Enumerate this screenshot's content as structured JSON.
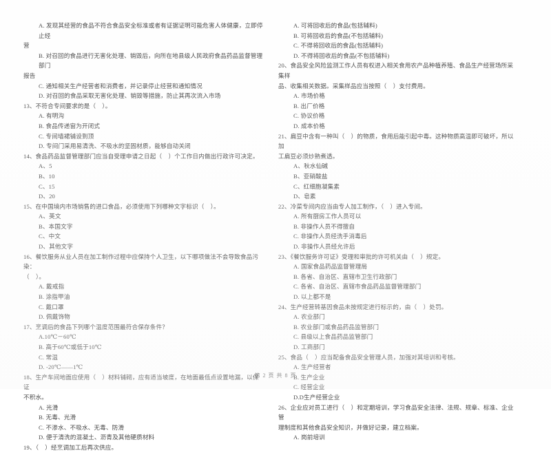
{
  "document": {
    "type": "exam-paper",
    "footer": "第 2 页 共 8 页",
    "page_number": "2",
    "total_pages": "8"
  },
  "left_column": {
    "lines": [
      "   A. 发现其经营的食品不符合食品安全标准或者有证据证明可能危害人体健康，立即停止经",
      "营",
      "   B. 对召回的食品进行无害化处理、销毁后，向所在地县级人民政府食品药品监督管理部门",
      "报告",
      "   C. 通知相关生产经营者和消费者，并记录停止经营和通知情况",
      "   D. 对召回的食品采取无害化处理、销毁等措施，防止其再次流入市场",
      "13、不符合专间要求的是（    ）。",
      "   A. 有明沟",
      "   B. 食品传递窗为开闭式",
      "   C. 专间墙裙铺设到顶",
      "   D. 专间门采用易清洗、不吸水的坚固材质，能够自动关闭",
      "14、食品药品监督管理部门应当自受理申请之日起（    ）个工作日内做出行政许可决定。",
      "   A、5",
      "   B、10",
      "   C、15",
      "   D、20",
      "15、在中国境内市场销售的进口食品，必须使用下列哪种文字标识（    ）。",
      "   A、英文",
      "   B、本国文字",
      "   C、中文",
      "   D、其他文字",
      "16、餐饮服务从业人员在加工制作过程中应保持个人卫生，以下哪项做法不会导致食品污染：",
      "（    ）。",
      "   A. 戴戒指",
      "   B. 涂指甲油",
      "   C. 戴口罩",
      "   D. 佩戴饰物",
      "17、烹调后的食品下列哪个温度范围最符合保存条件？",
      "   A.10℃－60℃",
      "   B. 高于60℃或低于10℃",
      "   C. 常温",
      "   D. -20℃——1℃",
      "18、生产车间地面应使用（    ）材料铺砌，应有适当坡度，在地面最低点设置地漏，以保证",
      "不积水。",
      "   A. 光滑",
      "   B. 无毒、光滑",
      "   C. 不渗水、不吸水、无毒、防滑",
      "   D. 便于清洗的混凝土、沥青及其他硬质材料",
      "19、（    ）经烹调加工后再次供应。"
    ]
  },
  "right_column": {
    "lines": [
      "   A. 可将回收后的食品(包括辅料)",
      "   B. 可将回收后的食品(不包括辅料)",
      "   C. 不得将回收后的食品(包括辅料)",
      "   D. 不得将回收后的食品(不包括辅料)",
      "20、食品安全风险监测工作人员有权进入相关食用农产品种植养殖、食品生产经营场所采集样",
      "品、收集相关数据。采集样品应当按照（    ）支付费用。",
      "   A. 市场价格",
      "   B. 出厂价格",
      "   C. 协议价格",
      "   D. 成本价格",
      "21、扁豆中含有一种叫（    ）的物质，食用后能引起中毒。这种物质高温即可破坏，所以加",
      "工扁豆必须炒熟煮透。",
      "   A、秋水仙碱",
      "   B、亚硝酸盐",
      "   C、红细胞凝集素",
      "   D、皂素",
      "22、冷菜专间内应当由专人加工制作，（    ）进入专间。",
      "   A. 所有厨房工作人员可以",
      "   B. 非操作人员不得擅自",
      "   C. 非操作人员经洗手消毒后",
      "   D. 非操作人员经允许后",
      "23、《餐饮服务许可证》受理和审批的许可机关由（    ）规定。",
      "   A. 国家食品药品监督管理局",
      "   B. 各省、自治区、直辖市卫生行政部门",
      "   C. 各省、自治区、直辖市食品药品监督管理部门",
      "   D. 以上都不是",
      "24、生产经营转基因食品未按规定进行标示的，由（    ）处罚。",
      "   A. 农业部门",
      "   B. 农业部门或食品药品监管部门",
      "   C. 县级以上食品药品监管部门",
      "   D. 工商部门",
      "25、食品（    ）应当配备食品安全管理人员，加强对其培训和考核。",
      "   A. 生产经营者",
      "   B. 生产企业",
      "   C. 经营企业",
      "   D.D生产经营企业",
      "26、企业应对员工进行（    ）和定期培训，学习食品安全法律、法规、规章、标准、企业管",
      "理制度和其他食品安全知识，并做好记录，建立档案。",
      "   A. 岗前培训"
    ]
  }
}
